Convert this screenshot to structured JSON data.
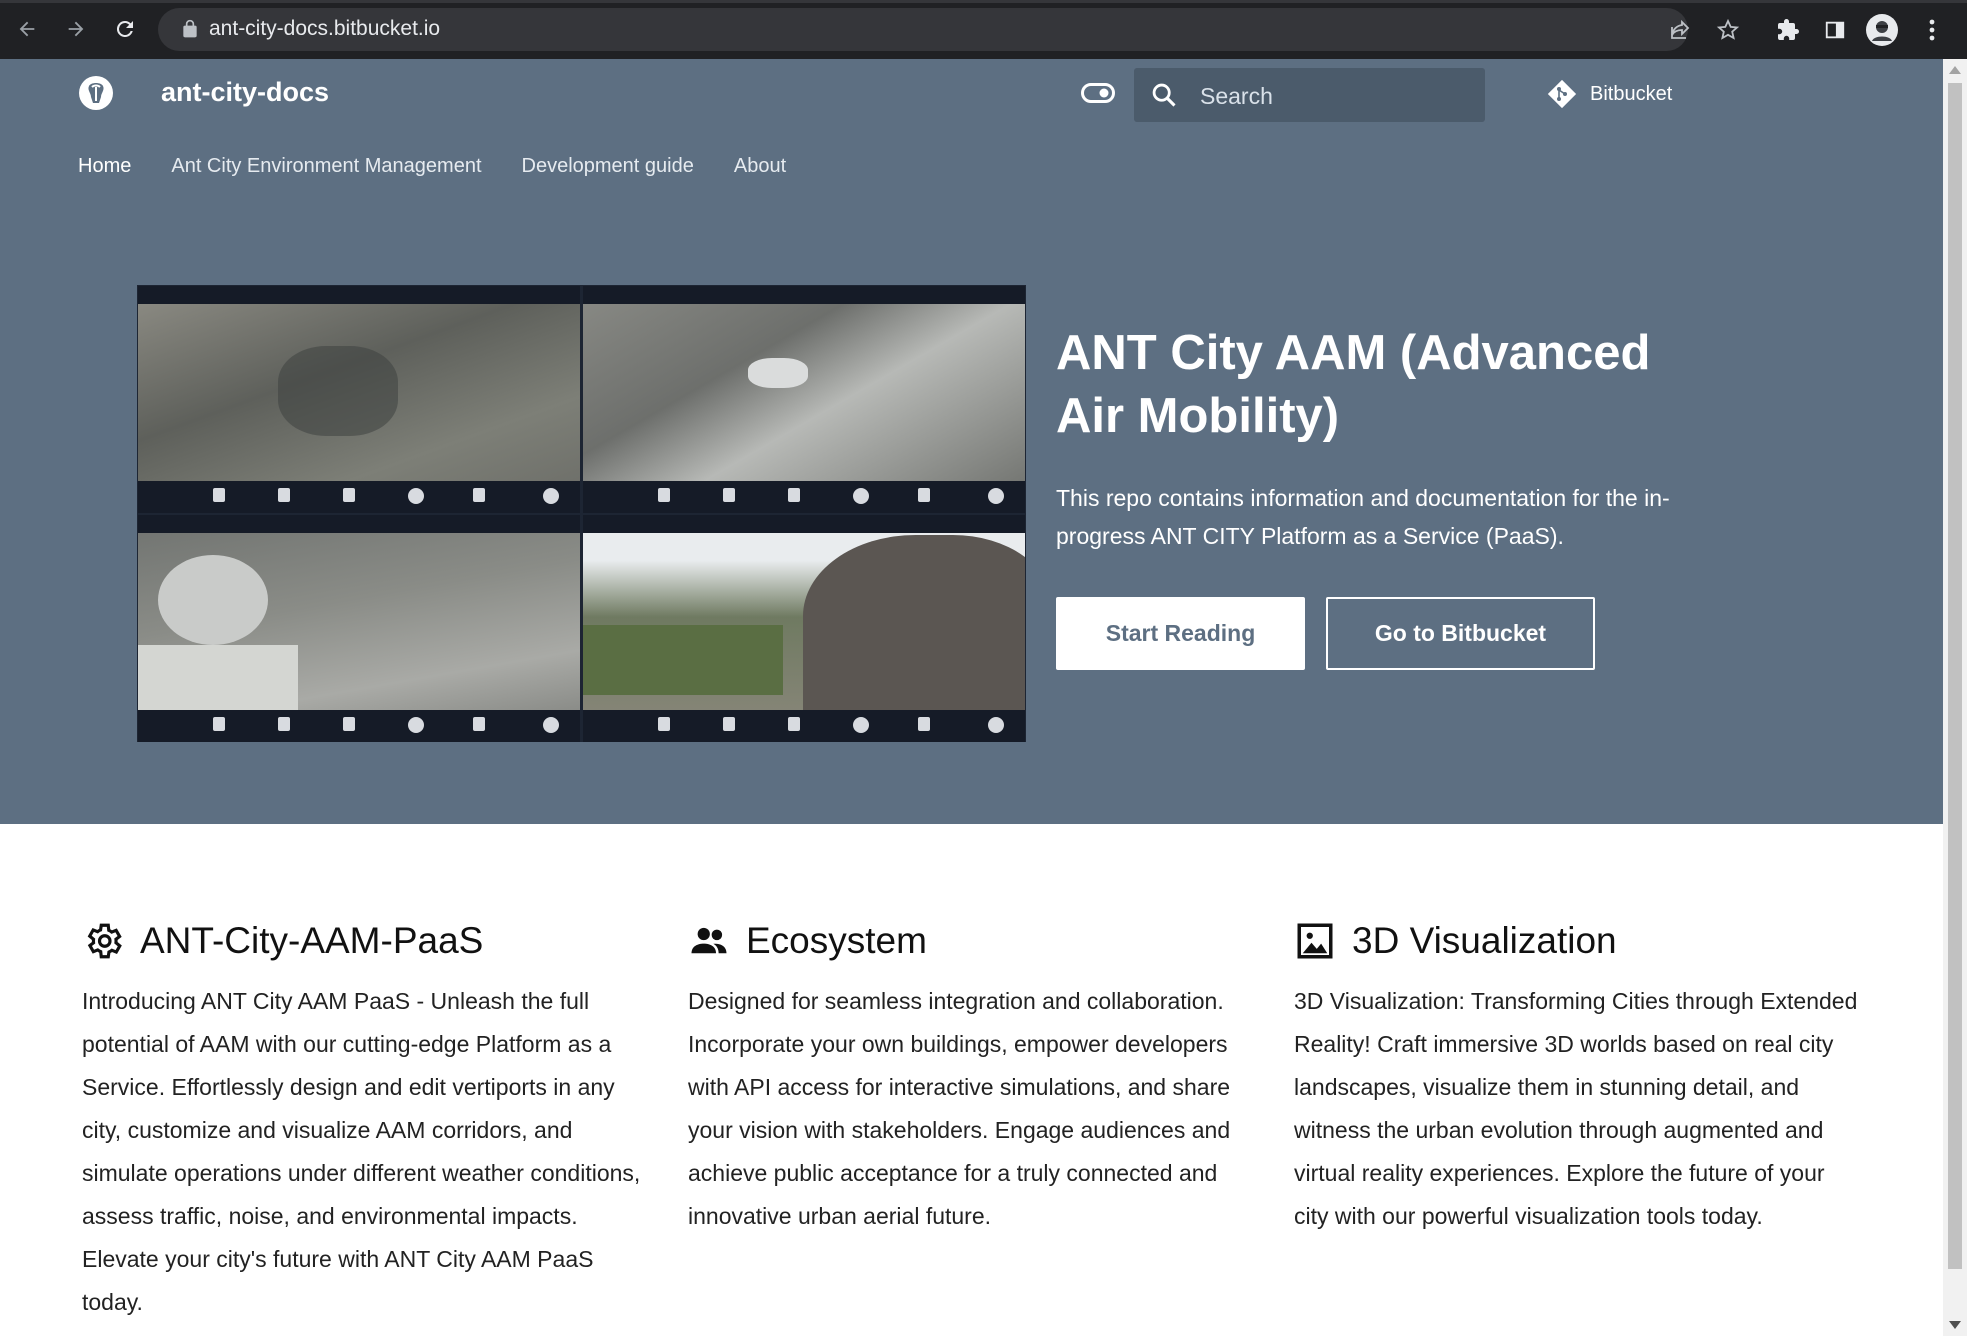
{
  "browser": {
    "url": "ant-city-docs.bitbucket.io"
  },
  "header": {
    "site_title": "ant-city-docs",
    "search_placeholder": "Search",
    "repo_label": "Bitbucket"
  },
  "nav": {
    "tabs": [
      {
        "label": "Home",
        "active": true
      },
      {
        "label": "Ant City Environment Management",
        "active": false
      },
      {
        "label": "Development guide",
        "active": false
      },
      {
        "label": "About",
        "active": false
      }
    ]
  },
  "hero": {
    "title": "ANT City AAM (Advanced Air Mobility)",
    "description": "This repo contains information and documentation for the in-progress ANT CITY Platform as a Service (PaaS).",
    "primary_button": "Start Reading",
    "secondary_button": "Go to Bitbucket"
  },
  "features": [
    {
      "icon": "gear-icon",
      "title": "ANT-City-AAM-PaaS",
      "text": "Introducing ANT City AAM PaaS - Unleash the full potential of AAM with our cutting-edge Platform as a Service. Effortlessly design and edit vertiports in any city, customize and visualize AAM corridors, and simulate operations under different weather conditions, assess traffic, noise, and environmental impacts. Elevate your city's future with ANT City AAM PaaS today."
    },
    {
      "icon": "people-icon",
      "title": "Ecosystem",
      "text": "Designed for seamless integration and collaboration. Incorporate your own buildings, empower developers with API access for interactive simulations, and share your vision with stakeholders. Engage audiences and achieve public acceptance for a truly connected and innovative urban aerial future."
    },
    {
      "icon": "image-icon",
      "title": "3D Visualization",
      "text": "3D Visualization: Transforming Cities through Extended Reality! Craft immersive 3D worlds based on real city landscapes, visualize them in stunning detail, and witness the urban evolution through augmented and virtual reality experiences. Explore the future of your city with our powerful visualization tools today."
    }
  ],
  "colors": {
    "header_bg": "#5d6f82",
    "browser_chrome": "#202124"
  }
}
